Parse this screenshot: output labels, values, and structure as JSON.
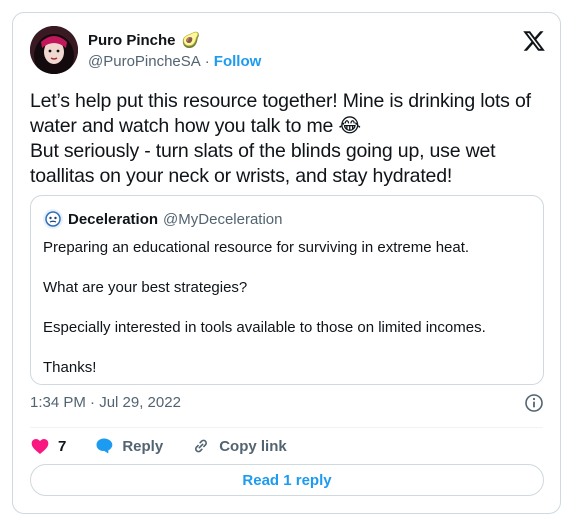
{
  "author": {
    "display_name": "Puro Pinche",
    "name_emoji": "🥑",
    "handle": "@PuroPincheSA",
    "separator": "·",
    "follow_label": "Follow"
  },
  "tweet": {
    "line1": "Let’s help put this resource together! Mine is drinking lots of water and watch how you talk to me 😂",
    "line2": "But seriously - turn slats of the blinds going up, use wet toallitas on your neck or wrists, and stay hydrated!"
  },
  "quoted": {
    "display_name": "Deceleration",
    "handle": "@MyDeceleration",
    "paragraphs": [
      "Preparing an educational resource for surviving in extreme heat.",
      "What are your best strategies?",
      "Especially interested in tools available to those on limited incomes.",
      "Thanks!"
    ]
  },
  "timestamp": "1:34 PM · Jul 29, 2022",
  "actions": {
    "like_count": "7",
    "reply_label": "Reply",
    "copy_link_label": "Copy link"
  },
  "read_replies_label": "Read 1 reply",
  "colors": {
    "accent": "#1d9bf0",
    "like": "#f91880",
    "secondary_text": "#536471",
    "border": "#cfd9de"
  },
  "icons": [
    "x-logo-icon",
    "heart-icon",
    "reply-bubble-icon",
    "link-icon",
    "info-icon"
  ]
}
